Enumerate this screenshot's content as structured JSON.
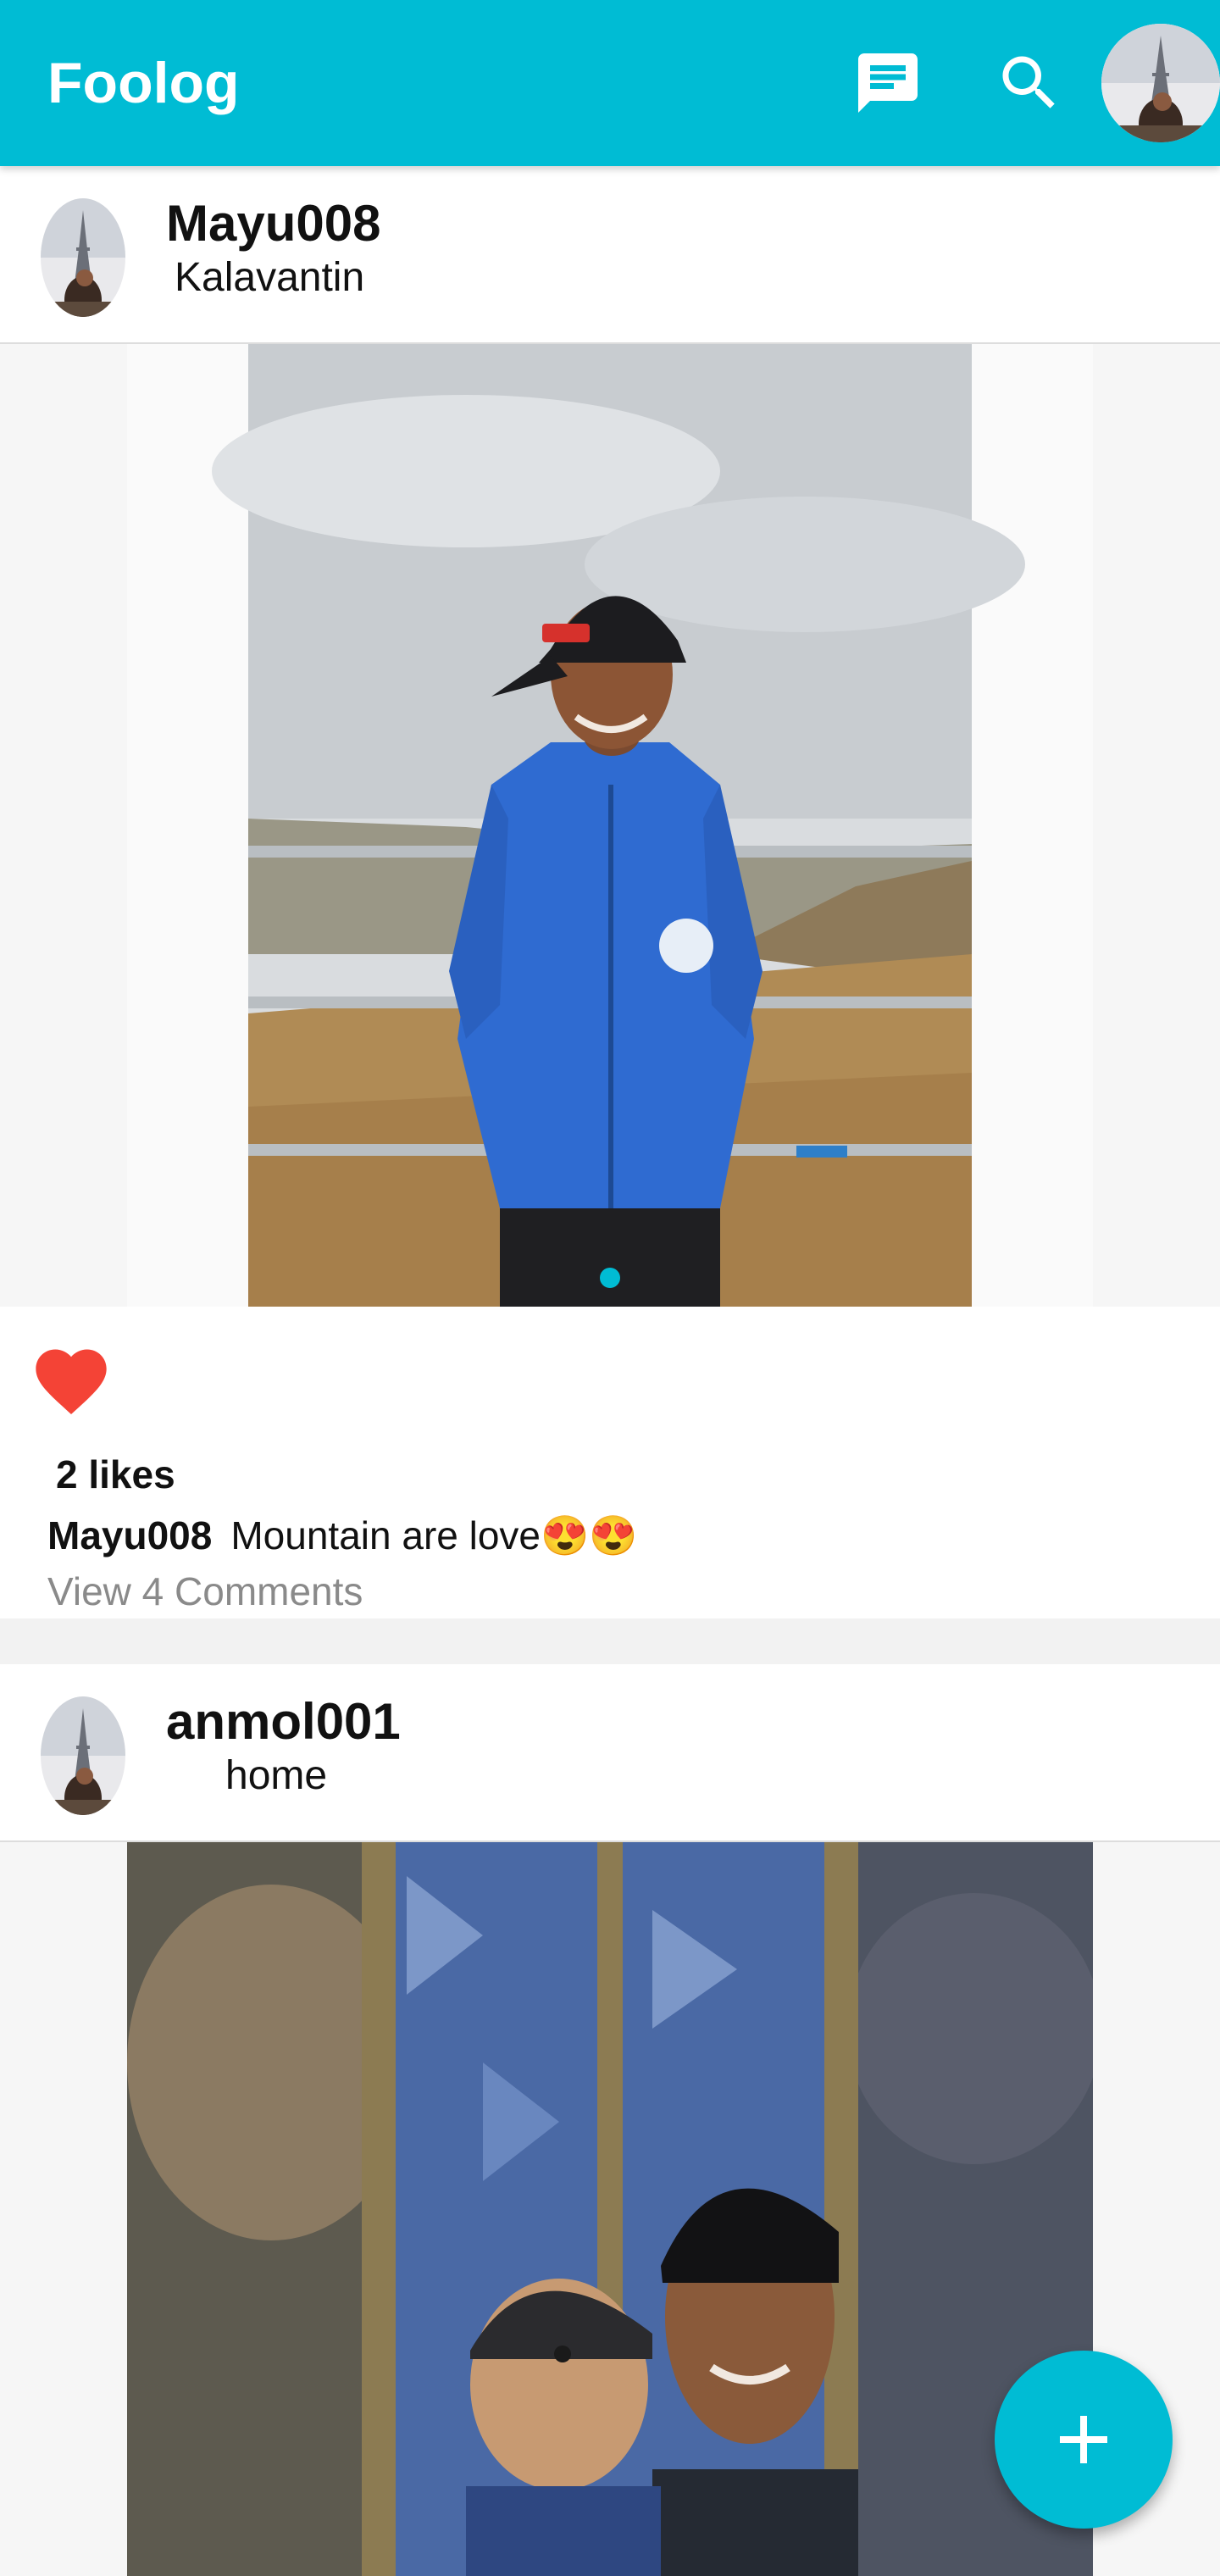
{
  "app": {
    "title": "Foolog",
    "accent_color": "#00BCD4",
    "icons": {
      "messages": "message-icon",
      "search": "search-icon",
      "add": "plus-icon",
      "like": "heart-icon"
    }
  },
  "posts": [
    {
      "username": "Mayu008",
      "location": "Kalavantin",
      "likes_text": "2 likes",
      "liked": true,
      "caption_user": "Mayu008",
      "caption_text": "Mountain are love😍😍",
      "comments_link": "View 4 Comments"
    },
    {
      "username": "anmol001",
      "location": "home"
    }
  ]
}
